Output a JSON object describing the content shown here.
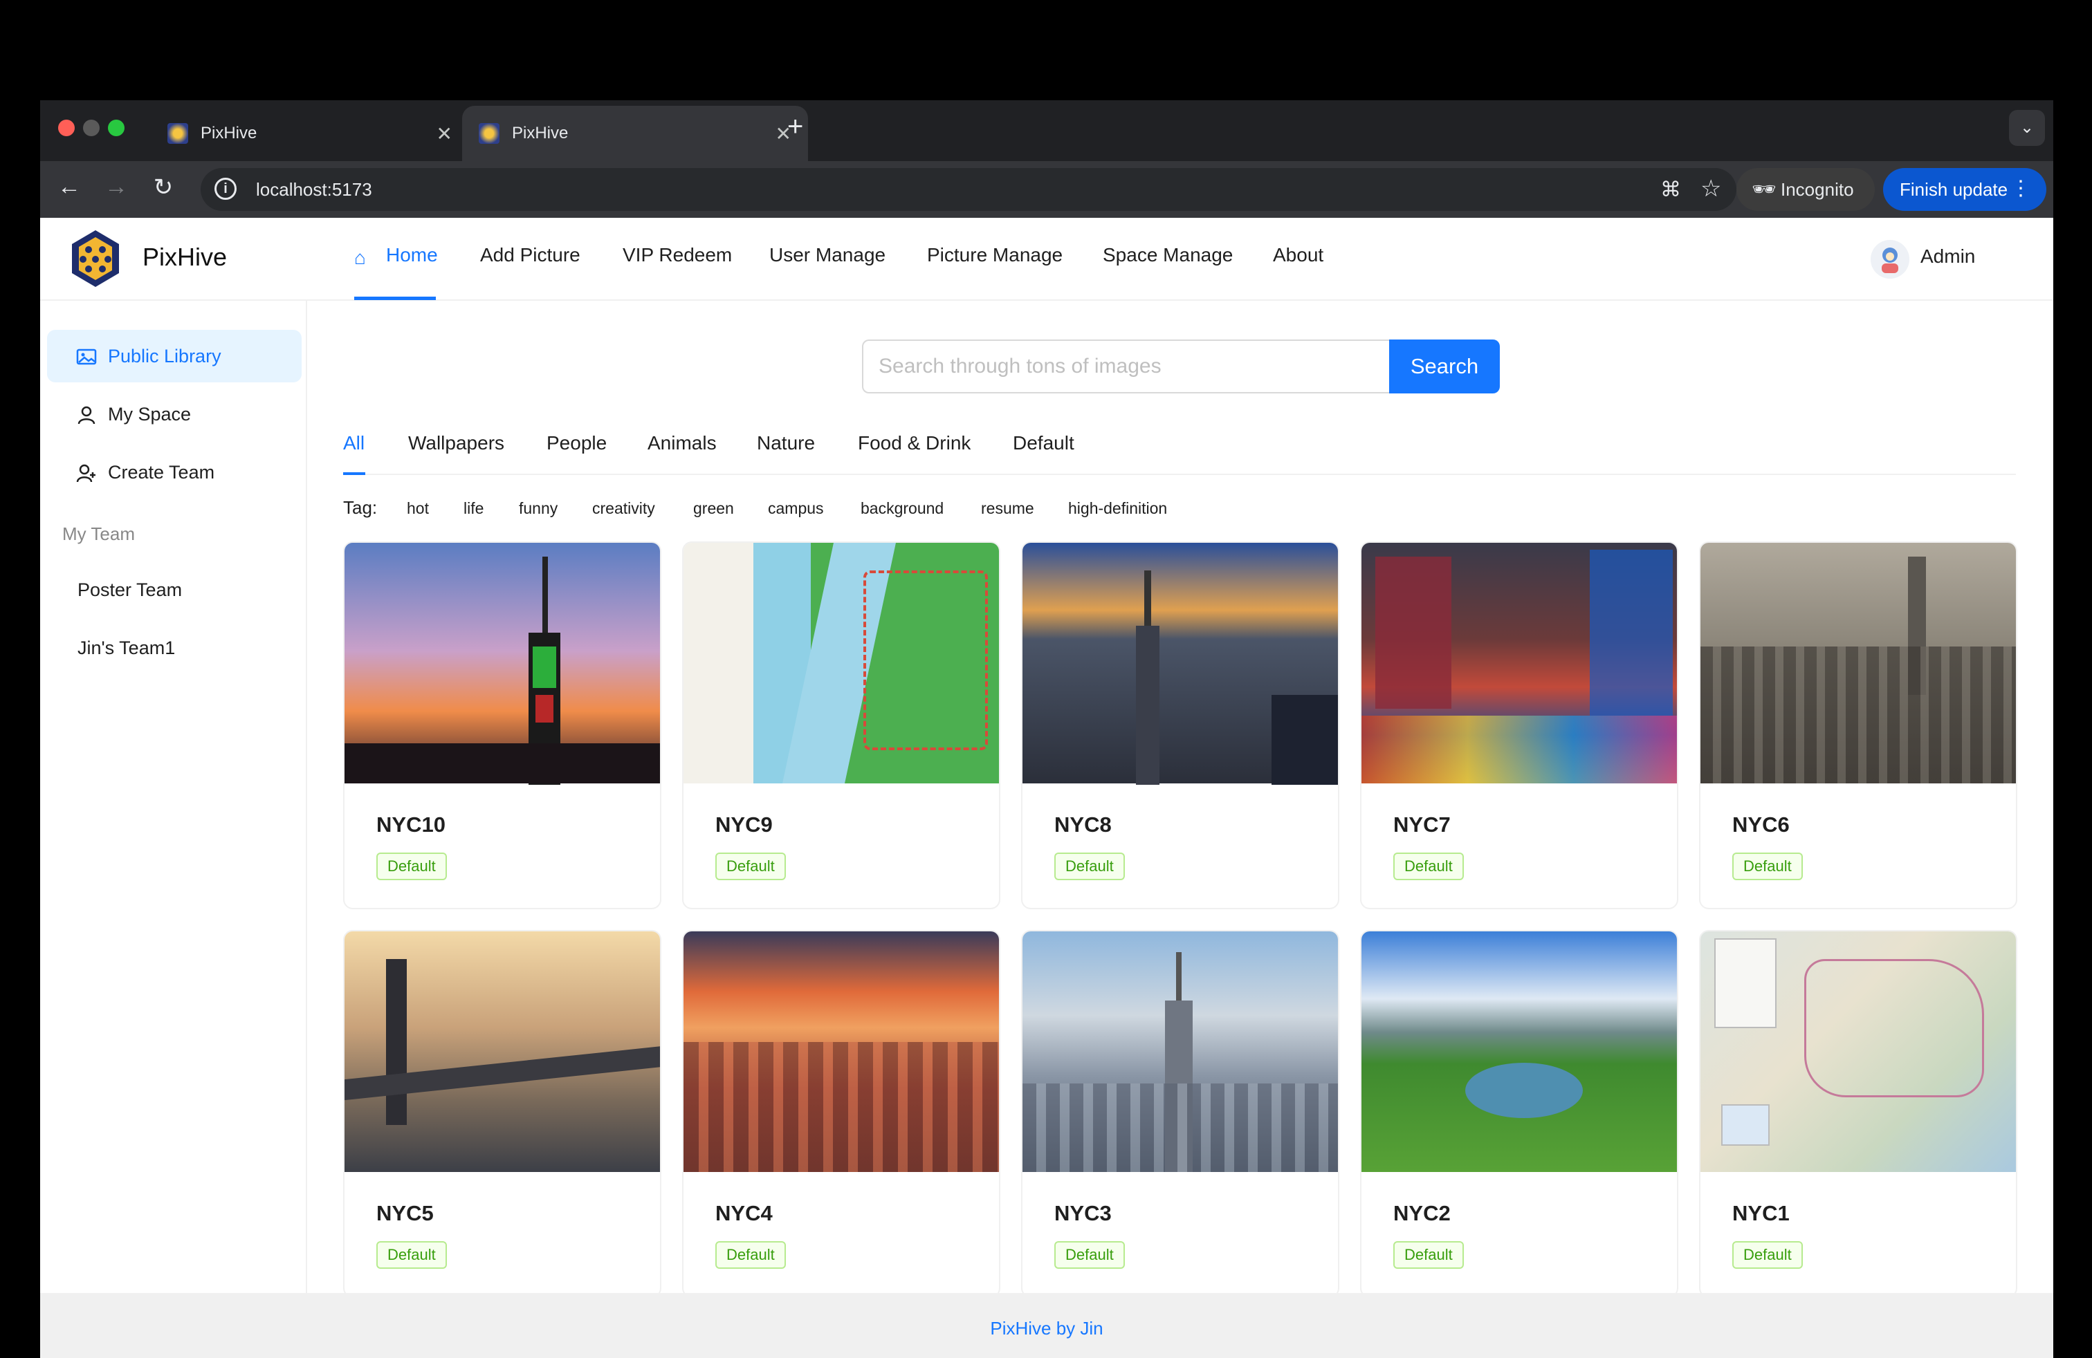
{
  "browser": {
    "tabs": [
      {
        "title": "PixHive"
      },
      {
        "title": "PixHive"
      }
    ],
    "new_tab": "+",
    "url": "localhost:5173",
    "incognito_label": "Incognito",
    "update_label": "Finish update"
  },
  "header": {
    "brand": "PixHive",
    "menu": [
      {
        "label": "Home"
      },
      {
        "label": "Add Picture"
      },
      {
        "label": "VIP Redeem"
      },
      {
        "label": "User Manage"
      },
      {
        "label": "Picture Manage"
      },
      {
        "label": "Space Manage"
      },
      {
        "label": "About"
      }
    ],
    "user": "Admin"
  },
  "sidebar": {
    "items": [
      {
        "label": "Public Library",
        "icon": "picture-icon"
      },
      {
        "label": "My Space",
        "icon": "user-icon"
      },
      {
        "label": "Create Team",
        "icon": "team-icon"
      }
    ],
    "group_title": "My Team",
    "teams": [
      {
        "label": "Poster Team"
      },
      {
        "label": "Jin's Team1"
      }
    ]
  },
  "search": {
    "placeholder": "Search through tons of images",
    "button": "Search"
  },
  "categories": [
    "All",
    "Wallpapers",
    "People",
    "Animals",
    "Nature",
    "Food & Drink",
    "Default"
  ],
  "tags": {
    "label": "Tag:",
    "items": [
      "hot",
      "life",
      "funny",
      "creativity",
      "green",
      "campus",
      "background",
      "resume",
      "high-definition"
    ]
  },
  "pictures": [
    {
      "name": "NYC10",
      "category": "Default"
    },
    {
      "name": "NYC9",
      "category": "Default"
    },
    {
      "name": "NYC8",
      "category": "Default"
    },
    {
      "name": "NYC7",
      "category": "Default"
    },
    {
      "name": "NYC6",
      "category": "Default"
    },
    {
      "name": "NYC5",
      "category": "Default"
    },
    {
      "name": "NYC4",
      "category": "Default"
    },
    {
      "name": "NYC3",
      "category": "Default"
    },
    {
      "name": "NYC2",
      "category": "Default"
    },
    {
      "name": "NYC1",
      "category": "Default"
    }
  ],
  "footer": "PixHive by Jin",
  "colors": {
    "primary": "#1677ff",
    "tag_green": "#389e0d",
    "chrome_dark": "#202124"
  }
}
